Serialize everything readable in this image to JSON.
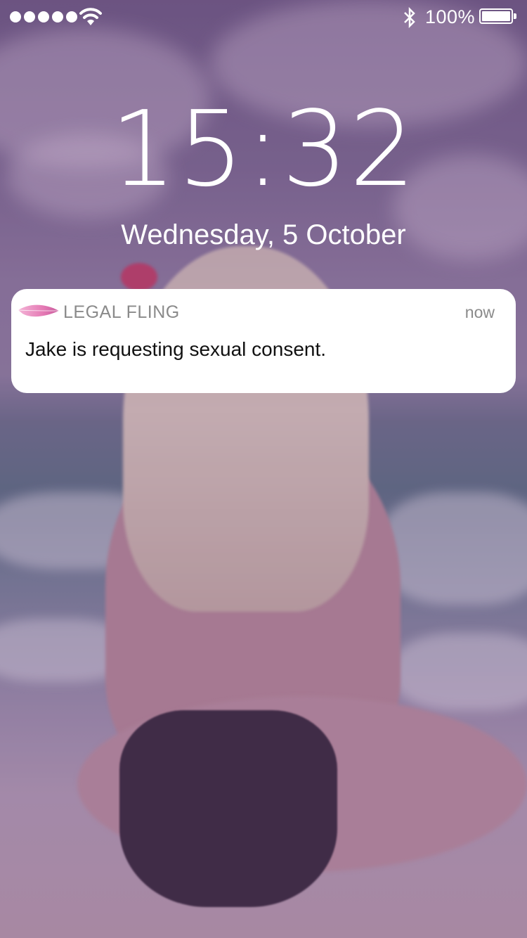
{
  "status_bar": {
    "signal_dots": 5,
    "wifi_icon": "wifi-icon",
    "bluetooth_icon": "bluetooth-icon",
    "battery_percent_text": "100%",
    "battery_level": 1.0
  },
  "lock_screen": {
    "time": "15:32",
    "date": "Wednesday, 5 October"
  },
  "notification": {
    "app_icon": "feather-icon",
    "app_name": "LEGAL FLING",
    "time": "now",
    "message": "Jake is requesting sexual consent."
  },
  "colors": {
    "tint": "#60386e",
    "notification_bg": "#ffffff",
    "app_icon_accent": "#e57bb5",
    "secondary_text": "#8a8a8a"
  }
}
